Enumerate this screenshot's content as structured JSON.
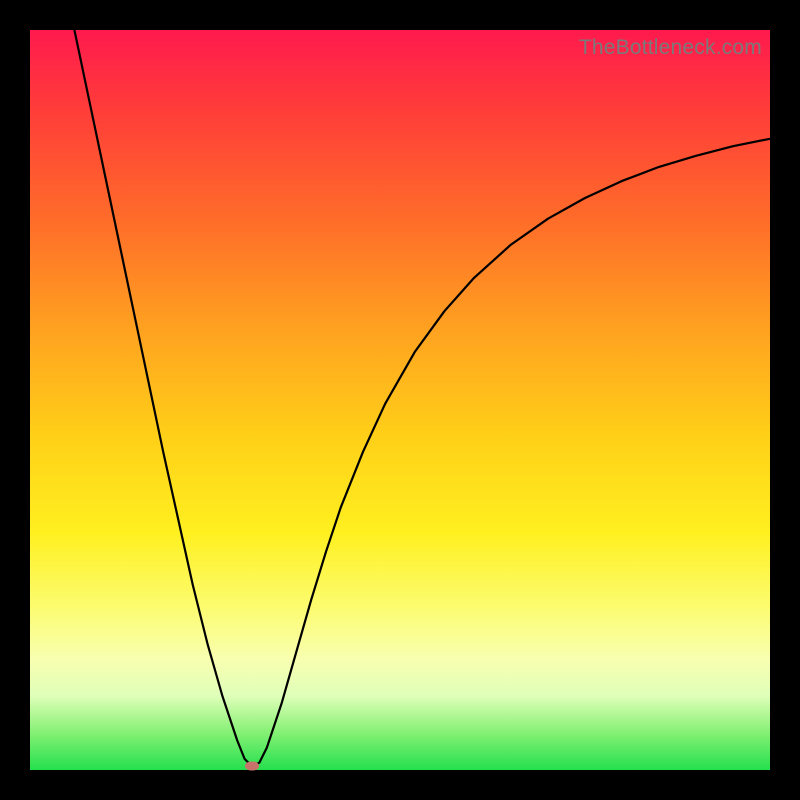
{
  "watermark": "TheBottleneck.com",
  "chart_data": {
    "type": "line",
    "title": "",
    "xlabel": "",
    "ylabel": "",
    "xlim": [
      0,
      100
    ],
    "ylim": [
      0,
      100
    ],
    "series": [
      {
        "name": "curve",
        "x": [
          6,
          8,
          10,
          12,
          14,
          16,
          18,
          20,
          22,
          24,
          26,
          28,
          29,
          30,
          31,
          32,
          34,
          36,
          38,
          40,
          42,
          45,
          48,
          52,
          56,
          60,
          65,
          70,
          75,
          80,
          85,
          90,
          95,
          100
        ],
        "values": [
          100,
          90.5,
          81,
          71.5,
          62,
          52.5,
          43,
          34,
          25,
          17,
          10,
          4,
          1.5,
          0.5,
          1,
          3,
          9,
          16,
          23,
          29.5,
          35.5,
          43,
          49.5,
          56.5,
          62,
          66.5,
          71,
          74.5,
          77.3,
          79.6,
          81.5,
          83.0,
          84.3,
          85.3
        ]
      }
    ],
    "marker": {
      "x": 30,
      "y": 0.5
    },
    "background_gradient": {
      "top": "#ff1a4e",
      "mid": "#ffd018",
      "bottom": "#24e04e"
    }
  }
}
